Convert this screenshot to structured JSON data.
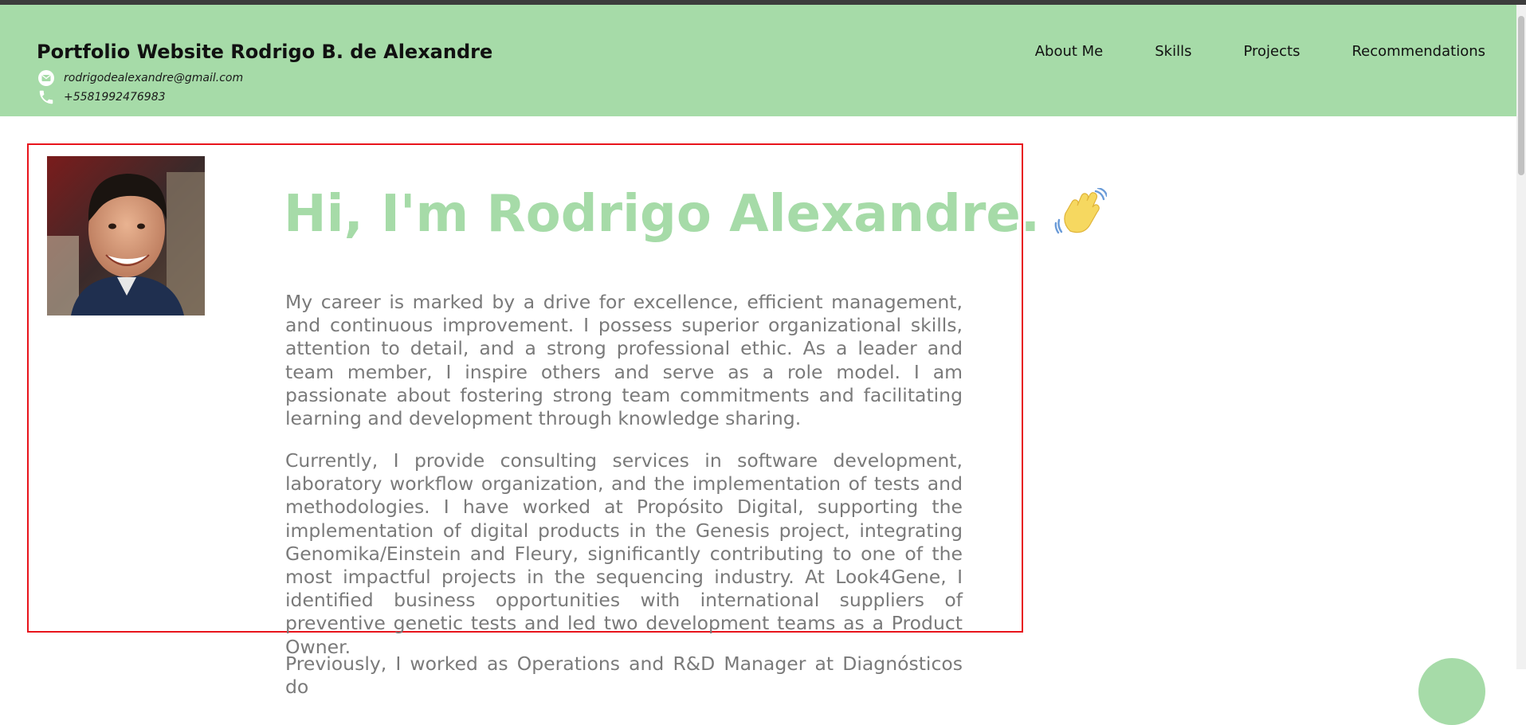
{
  "header": {
    "title": "Portfolio Website Rodrigo B. de Alexandre",
    "email": "rodrigodealexandre@gmail.com",
    "phone": "+5581992476983",
    "email_icon": "envelope-circle-icon",
    "phone_icon": "phone-icon"
  },
  "nav": {
    "items": [
      {
        "label": "About Me"
      },
      {
        "label": "Skills"
      },
      {
        "label": "Projects"
      },
      {
        "label": "Recommendations"
      }
    ]
  },
  "hero": {
    "headline": "Hi, I'm Rodrigo Alexandre.",
    "emoji": "waving-hand-icon",
    "photo": "profile-photo",
    "paragraphs": [
      "My career is marked by a drive for excellence, efficient management, and continuous improvement. I possess superior organizational skills, attention to detail, and a strong professional ethic. As a leader and team member, I inspire others and serve as a role model. I am passionate about fostering strong team commitments and facilitating learning and development through knowledge sharing.",
      "Currently, I provide consulting services in software development, laboratory workflow organization, and the implementation of tests and methodologies. I have worked at Propósito Digital, supporting the implementation of digital products in the Genesis project, integrating Genomika/Einstein and Fleury, significantly contributing to one of the most impactful projects in the sequencing industry. At Look4Gene, I identified business opportunities with international suppliers of preventive genetic tests and led two development teams as a Product Owner.",
      "Previously, I worked as Operations and R&D Manager at Diagnósticos do"
    ]
  },
  "colors": {
    "header_bg": "#a6dba8",
    "accent": "#a6dba8",
    "highlight_border": "#e8141c",
    "body_text": "#7a7a7a"
  }
}
